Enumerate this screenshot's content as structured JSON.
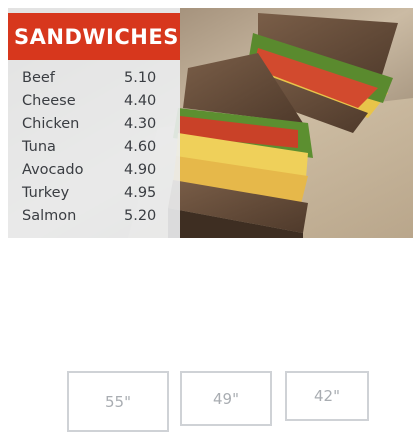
{
  "menu": {
    "title": "SANDWICHES",
    "items": [
      {
        "name": "Beef",
        "price": "5.10"
      },
      {
        "name": "Cheese",
        "price": "4.40"
      },
      {
        "name": "Chicken",
        "price": "4.30"
      },
      {
        "name": "Tuna",
        "price": "4.60"
      },
      {
        "name": "Avocado",
        "price": "4.90"
      },
      {
        "name": "Turkey",
        "price": "4.95"
      },
      {
        "name": "Salmon",
        "price": "5.20"
      }
    ]
  },
  "sizes": [
    {
      "label": "55\""
    },
    {
      "label": "49\""
    },
    {
      "label": "42\""
    }
  ],
  "colors": {
    "header_red": "#d7371d",
    "button_border": "#cfd2d6",
    "button_text": "#a9adb2"
  }
}
